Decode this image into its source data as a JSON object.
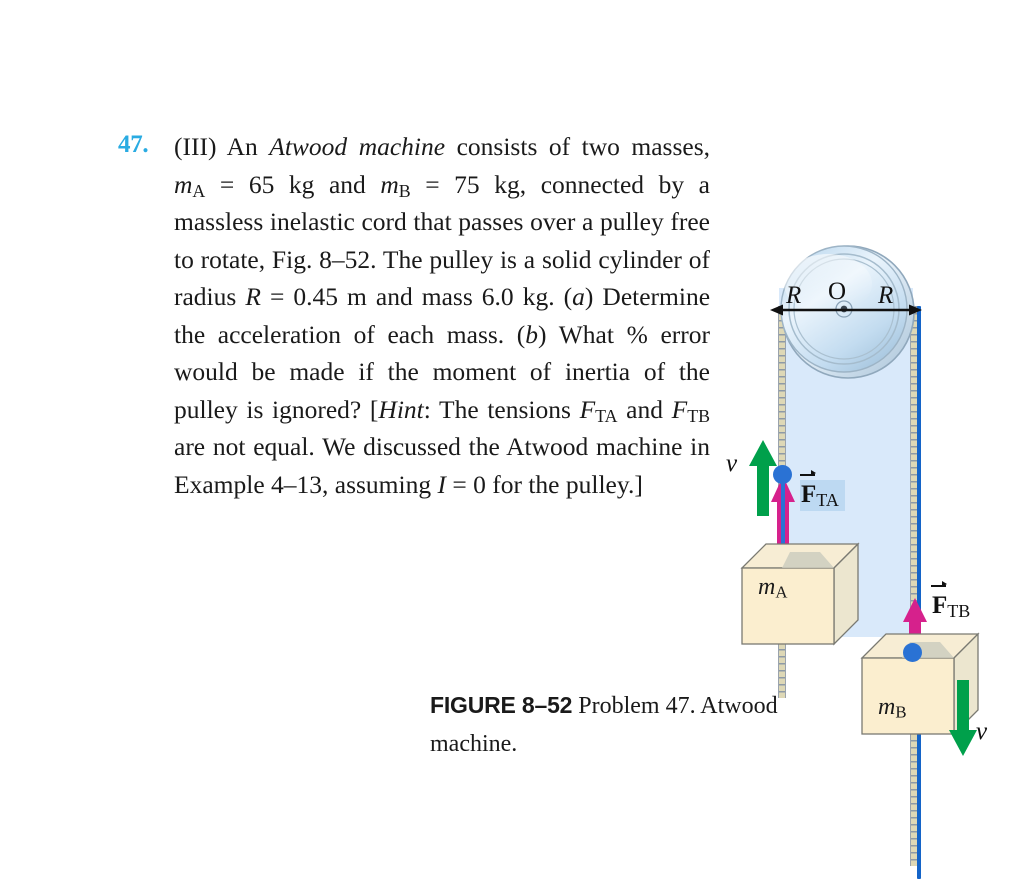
{
  "problem": {
    "number": "47.",
    "number_color": "#29abe2",
    "level": "(III)",
    "text_part1": "An ",
    "emphasis1": "Atwood machine",
    "text_part2": " consists of two masses, ",
    "mass_a_label": "m",
    "mass_a_sub": "A",
    "mass_a_value": " = 65 kg",
    "text_part3": "  and  ",
    "mass_b_label": "m",
    "mass_b_sub": "B",
    "mass_b_value": " = 75 kg,",
    "text_part4": " connected by a massless inelastic cord that passes over a pulley free to rotate, Fig. 8–52. The pulley is a solid cylinder of radius  ",
    "radius_symbol": "R",
    "radius_value": " = 0.45 m",
    "text_part5": "  and mass 6.0 kg. (",
    "part_a": "a",
    "text_part6": ") Determine the acceleration of each mass. (",
    "part_b": "b",
    "text_part7": ") What % error would be made if the moment of inertia of the pulley is ignored? [",
    "hint_word": "Hint",
    "text_part8": ": The tensions ",
    "tension_a_symbol": "F",
    "tension_a_sub": "TA",
    "text_part9": " and ",
    "tension_b_symbol": "F",
    "tension_b_sub": "TB",
    "text_part10": " are not equal. We discussed the Atwood machine in Example 4–13, assuming ",
    "inertia_symbol": "I",
    "inertia_value": " = 0",
    "text_part11": "  for the pulley.]"
  },
  "figure": {
    "pulley": {
      "center_label": "O",
      "radius_label_left": "R",
      "radius_label_right": "R",
      "fill_color": "#cfe4f5",
      "rim_color": "#8fa7bb"
    },
    "mass_a": {
      "symbol": "m",
      "subscript": "A",
      "box_color": "#f8ecd0"
    },
    "mass_b": {
      "symbol": "m",
      "subscript": "B",
      "box_color": "#f8ecd0"
    },
    "tension_a": {
      "symbol": "F",
      "subscript": "TA",
      "highlight_color": "#bdd9f2",
      "arrow_color": "#d6218c"
    },
    "tension_b": {
      "symbol": "F",
      "subscript": "TB",
      "arrow_color": "#d6218c"
    },
    "velocity_a": {
      "symbol": "v",
      "direction": "up",
      "arrow_color": "#00a04b"
    },
    "velocity_b": {
      "symbol": "v",
      "direction": "down",
      "arrow_color": "#00a04b"
    },
    "cord_color": "#ded8b6",
    "cord_highlight_color": "#1464c8",
    "panel_color": "#d9e9fa"
  },
  "caption": {
    "figure_number": "FIGURE 8–52",
    "text": "  Problem 47. Atwood machine."
  }
}
